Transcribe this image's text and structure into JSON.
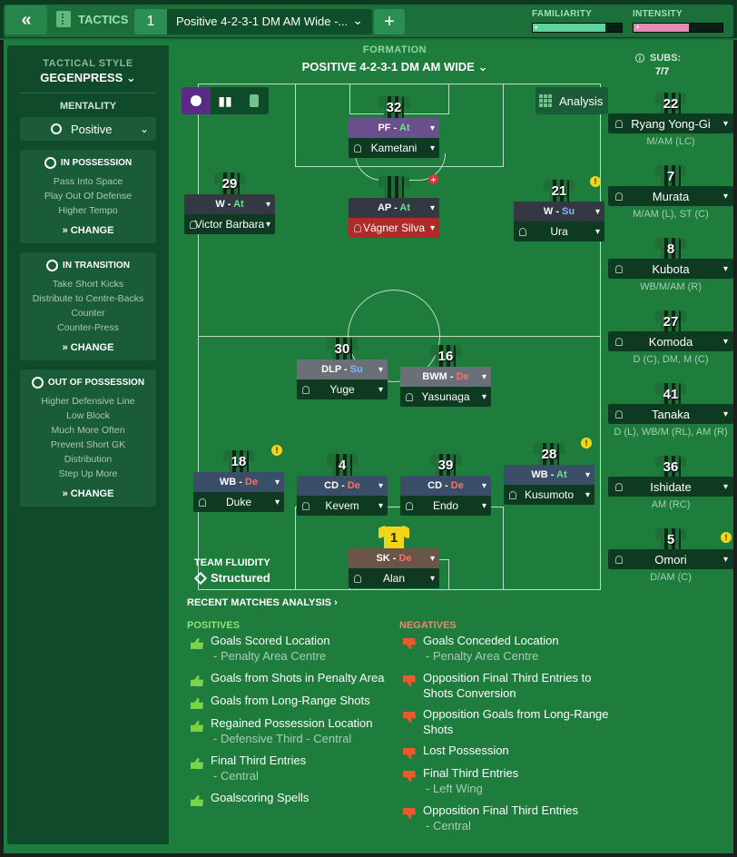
{
  "topbar": {
    "back_glyph": "«",
    "tactics_label": "TACTICS",
    "tactic_slot": "1",
    "tactic_name": "Positive 4-2-3-1 DM AM Wide -...",
    "add_glyph": "+",
    "familiarity_label": "FAMILIARITY",
    "intensity_label": "INTENSITY",
    "familiarity_level": 0.82,
    "intensity_level": 0.62,
    "familiarity_color": "#5fd3a0",
    "intensity_color": "#e38ab5"
  },
  "sidebar": {
    "tactical_style_label": "TACTICAL STYLE",
    "tactical_style": "GEGENPRESS",
    "mentality_label": "MENTALITY",
    "mentality": "Positive",
    "panels": [
      {
        "title": "IN POSSESSION",
        "items": [
          "Pass Into Space",
          "Play Out Of Defense",
          "Higher Tempo"
        ],
        "change": "CHANGE"
      },
      {
        "title": "IN TRANSITION",
        "items": [
          "Take Short Kicks",
          "Distribute to Centre-Backs",
          "Counter",
          "Counter-Press"
        ],
        "change": "CHANGE"
      },
      {
        "title": "OUT OF POSSESSION",
        "items": [
          "Higher Defensive Line",
          "Low Block",
          "Much More Often",
          "Prevent Short GK",
          "Distribution",
          "Step Up More"
        ],
        "change": "CHANGE"
      }
    ]
  },
  "formation": {
    "label": "FORMATION",
    "name": "POSITIVE 4-2-3-1 DM AM WIDE"
  },
  "analysis_button": "Analysis",
  "players": [
    {
      "num": "32",
      "role": "PF",
      "duty": "At",
      "name": "Kametani"
    },
    {
      "num": "29",
      "role": "W",
      "duty": "At",
      "name": "Victor Barbara"
    },
    {
      "num": "",
      "role": "AP",
      "duty": "At",
      "name": "Vágner Silva"
    },
    {
      "num": "21",
      "role": "W",
      "duty": "Su",
      "name": "Ura"
    },
    {
      "num": "30",
      "role": "DLP",
      "duty": "Su",
      "name": "Yuge"
    },
    {
      "num": "16",
      "role": "BWM",
      "duty": "De",
      "name": "Yasunaga"
    },
    {
      "num": "18",
      "role": "WB",
      "duty": "De",
      "name": "Duke"
    },
    {
      "num": "4",
      "role": "CD",
      "duty": "De",
      "name": "Kevem"
    },
    {
      "num": "39",
      "role": "CD",
      "duty": "De",
      "name": "Endo"
    },
    {
      "num": "28",
      "role": "WB",
      "duty": "At",
      "name": "Kusumoto"
    },
    {
      "num": "1",
      "role": "SK",
      "duty": "De",
      "name": "Alan"
    }
  ],
  "fluidity": {
    "label": "TEAM FLUIDITY",
    "value": "Structured"
  },
  "subs": {
    "label": "SUBS:",
    "count": "7/7",
    "list": [
      {
        "num": "22",
        "name": "Ryang Yong-Gi",
        "pos": "M/AM (LC)"
      },
      {
        "num": "7",
        "name": "Murata",
        "pos": "M/AM (L), ST (C)"
      },
      {
        "num": "8",
        "name": "Kubota",
        "pos": "WB/M/AM (R)"
      },
      {
        "num": "27",
        "name": "Komoda",
        "pos": "D (C), DM, M (C)"
      },
      {
        "num": "41",
        "name": "Tanaka",
        "pos": "D (L), WB/M (RL), AM (R)"
      },
      {
        "num": "36",
        "name": "Ishidate",
        "pos": "AM (RC)"
      },
      {
        "num": "5",
        "name": "Omori",
        "pos": "D/AM (C)"
      }
    ]
  },
  "recent": {
    "title": "RECENT MATCHES ANALYSIS",
    "positives_label": "POSITIVES",
    "negatives_label": "NEGATIVES",
    "positives": [
      {
        "text": "Goals Scored Location",
        "sub": "- Penalty Area Centre"
      },
      {
        "text": "Goals from Shots in Penalty Area",
        "sub": ""
      },
      {
        "text": "Goals from Long-Range Shots",
        "sub": ""
      },
      {
        "text": "Regained Possession Location",
        "sub": "- Defensive Third - Central"
      },
      {
        "text": "Final Third Entries",
        "sub": "- Central"
      },
      {
        "text": "Goalscoring Spells",
        "sub": ""
      }
    ],
    "negatives": [
      {
        "text": "Goals Conceded Location",
        "sub": "- Penalty Area Centre"
      },
      {
        "text": "Opposition Final Third Entries to",
        "text2": "Shots Conversion",
        "sub": ""
      },
      {
        "text": "Opposition Goals from Long-Range",
        "text2": "Shots",
        "sub": ""
      },
      {
        "text": "Lost Possession",
        "sub": ""
      },
      {
        "text": "Final Third Entries",
        "sub": "- Left Wing"
      },
      {
        "text": "Opposition Final Third Entries",
        "sub": "- Central"
      }
    ]
  }
}
